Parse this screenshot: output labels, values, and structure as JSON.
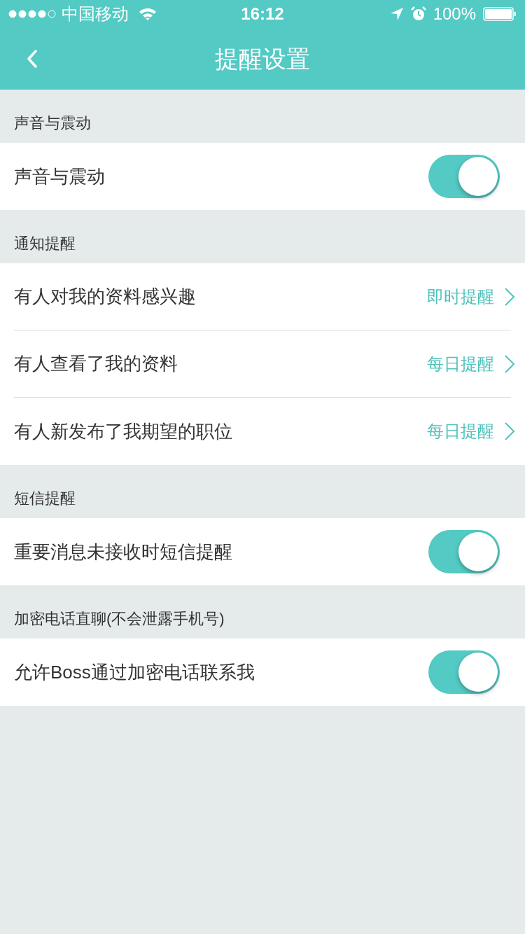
{
  "status_bar": {
    "carrier": "中国移动",
    "time": "16:12",
    "battery": "100%"
  },
  "nav_bar": {
    "title": "提醒设置"
  },
  "sections": [
    {
      "title": "声音与震动",
      "rows": [
        {
          "kind": "toggle",
          "label": "声音与震动",
          "on": true
        }
      ]
    },
    {
      "title": "通知提醒",
      "rows": [
        {
          "kind": "link",
          "label": "有人对我的资料感兴趣",
          "value": "即时提醒"
        },
        {
          "kind": "link",
          "label": "有人查看了我的资料",
          "value": "每日提醒"
        },
        {
          "kind": "link",
          "label": "有人新发布了我期望的职位",
          "value": "每日提醒"
        }
      ]
    },
    {
      "title": "短信提醒",
      "rows": [
        {
          "kind": "toggle",
          "label": "重要消息未接收时短信提醒",
          "on": true
        }
      ]
    },
    {
      "title": "加密电话直聊(不会泄露手机号)",
      "rows": [
        {
          "kind": "toggle",
          "label": "允许Boss通过加密电话联系我",
          "on": true
        }
      ]
    }
  ]
}
